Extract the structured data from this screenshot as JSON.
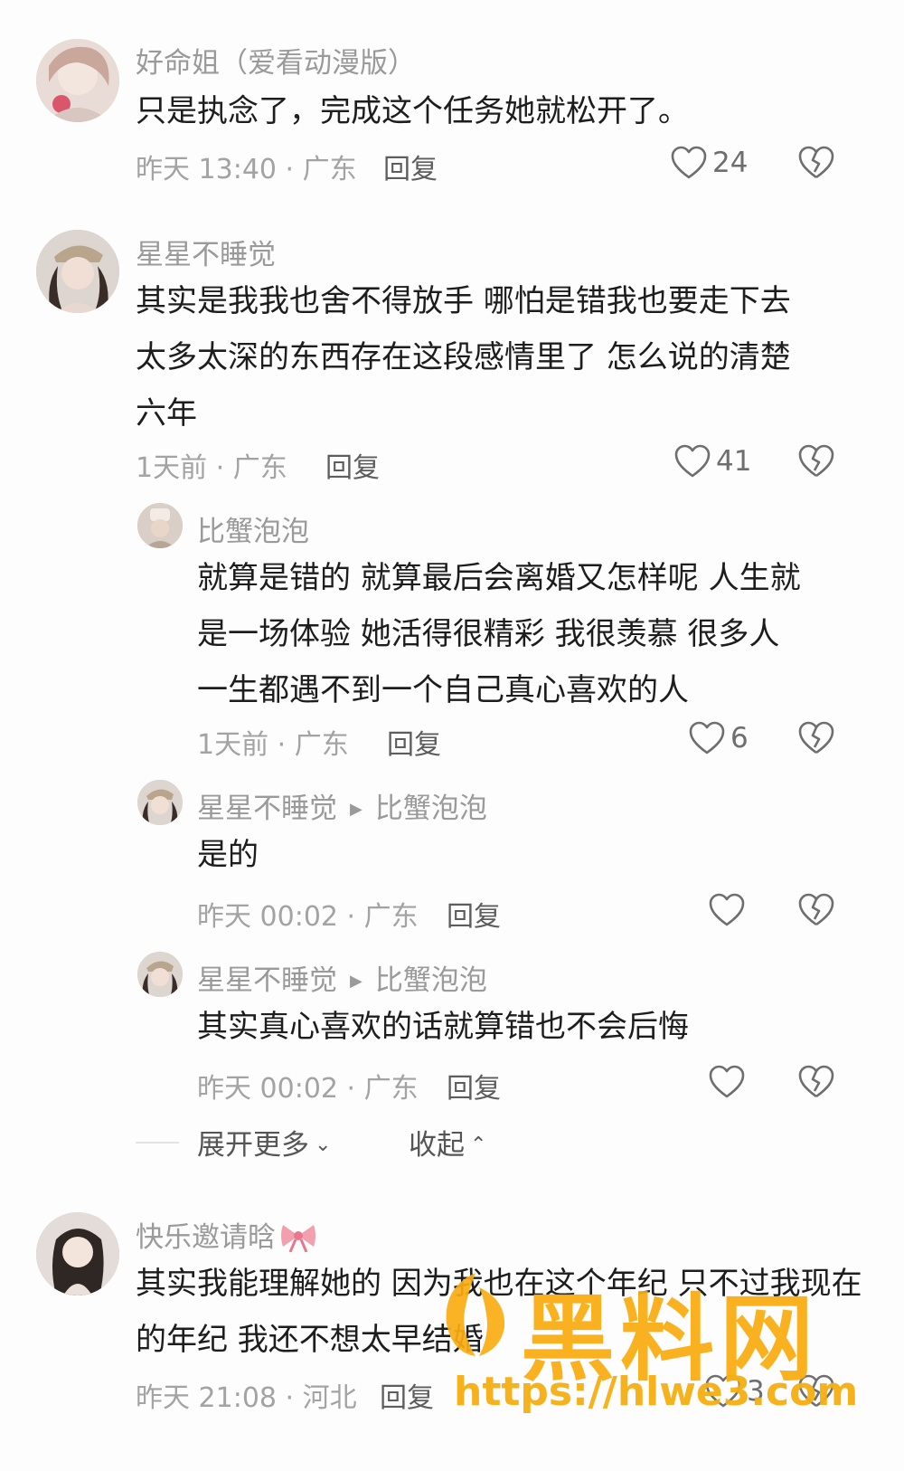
{
  "comments": [
    {
      "username": "好命姐（爱看动漫版）",
      "lines": [
        "只是执念了，完成这个任务她就松开了。"
      ],
      "meta": "昨天 13:40 · 广东",
      "reply": "回复",
      "likes": "24"
    },
    {
      "username": "星星不睡觉",
      "lines": [
        "其实是我我也舍不得放手 哪怕是错我也要走下去",
        "太多太深的东西存在这段感情里了 怎么说的清楚",
        "六年"
      ],
      "meta": "1天前 · 广东",
      "reply": "回复",
      "likes": "41"
    },
    {
      "username": "快乐邀请晗",
      "lines": [
        "其实我能理解她的 因为我也在这个年纪 只不过我现在",
        "的年纪 我还不想太早结婚"
      ],
      "meta": "昨天 21:08 · 河北",
      "reply": "回复",
      "likes": "3"
    }
  ],
  "replies": [
    {
      "username": "比蟹泡泡",
      "lines": [
        "就算是错的 就算最后会离婚又怎样呢 人生就",
        "是一场体验 她活得很精彩 我很羡慕 很多人",
        "一生都遇不到一个自己真心喜欢的人"
      ],
      "meta": "1天前 · 广东",
      "reply": "回复",
      "likes": "6"
    },
    {
      "username": "星星不睡觉",
      "reply_to": "比蟹泡泡",
      "lines": [
        "是的"
      ],
      "meta": "昨天 00:02 · 广东",
      "reply": "回复",
      "likes": ""
    },
    {
      "username": "星星不睡觉",
      "reply_to": "比蟹泡泡",
      "lines": [
        "其实真心喜欢的话就算错也不会后悔"
      ],
      "meta": "昨天 00:02 · 广东",
      "reply": "回复",
      "likes": ""
    }
  ],
  "thread_controls": {
    "expand_label": "展开更多",
    "collapse_label": "收起"
  },
  "watermark": {
    "title": "黑料网",
    "url": "https://hlwe3.com"
  },
  "colors": {
    "text": "#1d1d1d",
    "muted": "#9a9a9a",
    "watermark": "#faac12"
  },
  "icons": [
    "heart-outline-icon",
    "broken-heart-icon",
    "chevron-down-icon",
    "chevron-up-icon",
    "bow-emoji-icon"
  ]
}
